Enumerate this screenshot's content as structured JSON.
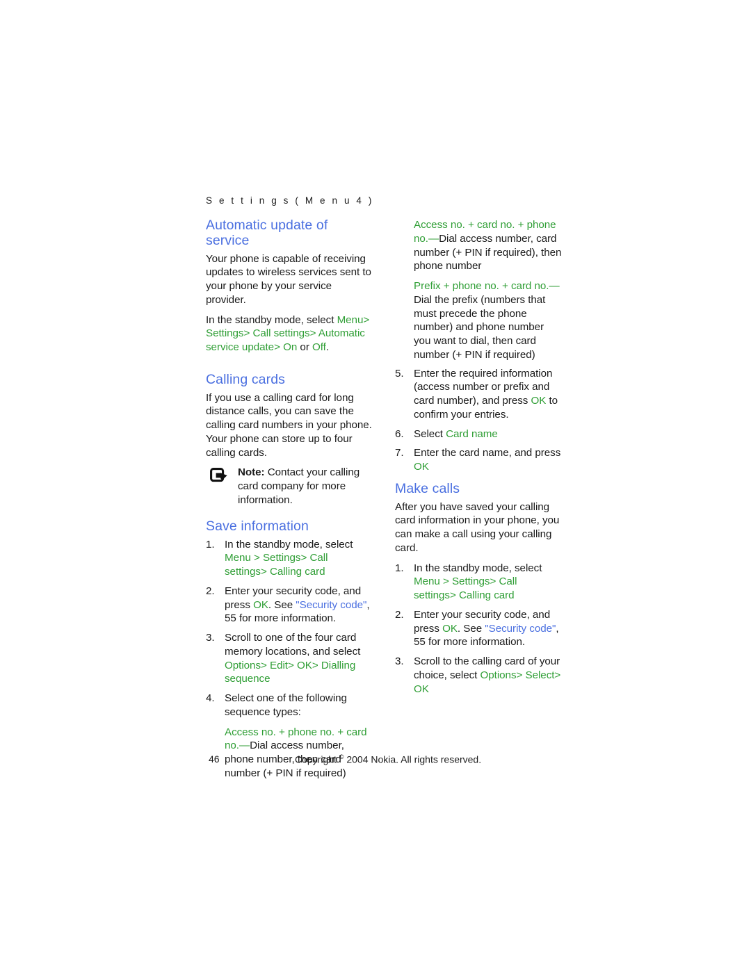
{
  "running_header": "S e t t i n g s   ( M e n u   4 )",
  "colors": {
    "heading_blue": "#4a6fe0",
    "ui_term_green": "#2f9e35",
    "xref_blue": "#4a6fe0",
    "body_text": "#1a1a1a",
    "page_background": "#ffffff"
  },
  "left_column": {
    "section_1": {
      "heading": "Automatic update of service",
      "paragraph_1": "Your phone is capable of receiving updates to wireless services sent to your phone by your service provider.",
      "paragraph_2": {
        "lead": "In the standby mode, select ",
        "path": [
          "Menu",
          "Settings",
          "Call settings",
          "Automatic service update"
        ],
        "separator": ">",
        "tail_on": "On",
        "tail_or": " or ",
        "tail_off": "Off",
        "tail_period": "."
      }
    },
    "section_2": {
      "heading": "Calling cards",
      "paragraph_1": "If you use a calling card for long distance calls, you can save the calling card numbers in your phone. Your phone can store up to four calling cards.",
      "note": {
        "icon": "note-arrow-icon",
        "label": "Note:",
        "text": " Contact your calling card company for more information."
      }
    },
    "section_3": {
      "heading": "Save information",
      "steps": [
        {
          "num": "1.",
          "lead": "In the standby mode, select ",
          "path": [
            "Menu",
            "Settings",
            "Call settings",
            "Calling card"
          ],
          "separator": ">"
        },
        {
          "num": "2.",
          "lead": "Enter your security code, and press ",
          "ui": "OK",
          "mid": ". See ",
          "xref": "\"Security code\"",
          "xref_tail": ", 55",
          "tail": " for more information."
        },
        {
          "num": "3.",
          "lead": "Scroll to one of the four card memory locations, and select ",
          "path": [
            "Options",
            "Edit",
            "OK",
            "Dialling sequence"
          ],
          "separator": ">"
        },
        {
          "num": "4.",
          "lead": "Select one of the following sequence types:",
          "subpara": {
            "term": "Access no. + phone no. + card no.",
            "dash": "—",
            "text": "Dial access number, phone number, then card number (+ PIN if required)"
          }
        }
      ]
    }
  },
  "right_column": {
    "sequence_types": [
      {
        "term": "Access no. + card no. + phone no.",
        "dash": "—",
        "text": "Dial access number, card number (+ PIN if required), then phone number"
      },
      {
        "term": "Prefix + phone no. + card no.",
        "dash": "—",
        "text": "Dial the prefix (numbers that must precede the phone number) and phone number you want to dial, then card number (+ PIN if required)"
      }
    ],
    "steps_continued": [
      {
        "num": "5.",
        "lead": "Enter the required information (access number or prefix and card number), and press ",
        "ui": "OK",
        "tail": " to confirm your entries."
      },
      {
        "num": "6.",
        "lead": "Select ",
        "ui": "Card name"
      },
      {
        "num": "7.",
        "lead": "Enter the card name, and press ",
        "ui": "OK"
      }
    ],
    "section_make_calls": {
      "heading": "Make calls",
      "paragraph_1": "After you have saved your calling card information in your phone, you can make a call using your calling card.",
      "steps": [
        {
          "num": "1.",
          "lead": "In the standby mode, select ",
          "path": [
            "Menu",
            "Settings",
            "Call settings",
            "Calling card"
          ],
          "separator": ">"
        },
        {
          "num": "2.",
          "lead": "Enter your security code, and press ",
          "ui": "OK",
          "mid": ". See ",
          "xref": "\"Security code\"",
          "xref_tail": ", 55",
          "tail": " for more information."
        },
        {
          "num": "3.",
          "lead": "Scroll to the calling card of your choice, select ",
          "path": [
            "Options",
            "Select",
            "OK"
          ],
          "separator": ">"
        }
      ]
    }
  },
  "footer": {
    "page_number": "46",
    "copyright_pre": "Copyright ",
    "copyright_symbol": "©",
    "copyright_post": " 2004 Nokia. All rights reserved."
  }
}
